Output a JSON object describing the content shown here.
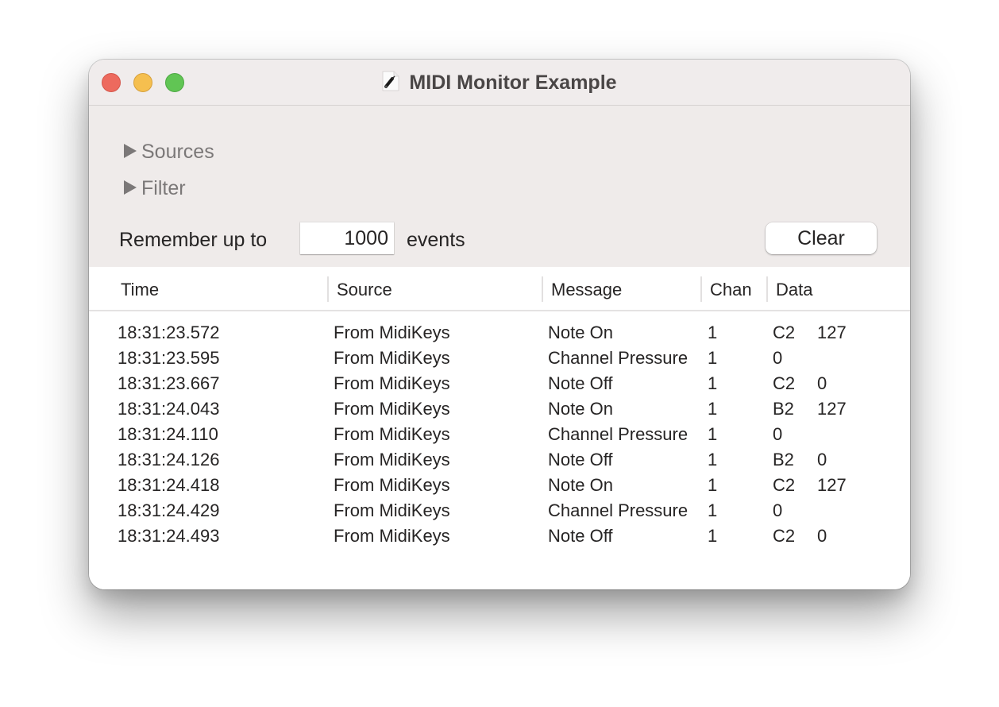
{
  "window": {
    "title": "MIDI Monitor Example",
    "title_icon": "midi-cable-document-icon",
    "buttons": [
      "close",
      "minimize",
      "zoom"
    ]
  },
  "panel": {
    "sources_label": "Sources",
    "filter_label": "Filter",
    "remember_prefix": "Remember up to",
    "remember_count": "1000",
    "remember_suffix": "events",
    "clear_label": "Clear"
  },
  "table": {
    "columns": [
      "Time",
      "Source",
      "Message",
      "Chan",
      "Data"
    ],
    "rows": [
      {
        "time": "18:31:23.572",
        "source": "From MidiKeys",
        "message": "Note On",
        "chan": "1",
        "data1": "C2",
        "data2": "127"
      },
      {
        "time": "18:31:23.595",
        "source": "From MidiKeys",
        "message": "Channel Pressure",
        "chan": "1",
        "data1": "0",
        "data2": ""
      },
      {
        "time": "18:31:23.667",
        "source": "From MidiKeys",
        "message": "Note Off",
        "chan": "1",
        "data1": "C2",
        "data2": "0"
      },
      {
        "time": "18:31:24.043",
        "source": "From MidiKeys",
        "message": "Note On",
        "chan": "1",
        "data1": "B2",
        "data2": "127"
      },
      {
        "time": "18:31:24.110",
        "source": "From MidiKeys",
        "message": "Channel Pressure",
        "chan": "1",
        "data1": "0",
        "data2": ""
      },
      {
        "time": "18:31:24.126",
        "source": "From MidiKeys",
        "message": "Note Off",
        "chan": "1",
        "data1": "B2",
        "data2": "0"
      },
      {
        "time": "18:31:24.418",
        "source": "From MidiKeys",
        "message": "Note On",
        "chan": "1",
        "data1": "C2",
        "data2": "127"
      },
      {
        "time": "18:31:24.429",
        "source": "From MidiKeys",
        "message": "Channel Pressure",
        "chan": "1",
        "data1": "0",
        "data2": ""
      },
      {
        "time": "18:31:24.493",
        "source": "From MidiKeys",
        "message": "Note Off",
        "chan": "1",
        "data1": "C2",
        "data2": "0"
      }
    ]
  }
}
